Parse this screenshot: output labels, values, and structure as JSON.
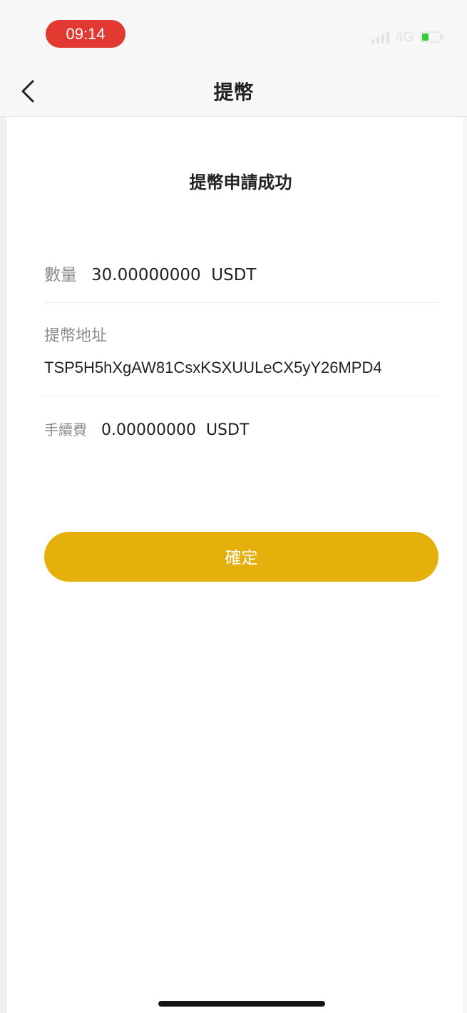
{
  "status_bar": {
    "time": "09:14",
    "network": "4G",
    "time_pill_color": "#e23a30",
    "battery_color": "#2fcf3a"
  },
  "header": {
    "title": "提幣",
    "back_icon": "chevron-left-icon"
  },
  "result": {
    "title": "提幣申請成功"
  },
  "details": {
    "amount_label": "數量",
    "amount_value": "30.00000000  USDT",
    "address_label": "提幣地址",
    "address_value": "TSP5H5hXgAW81CsxKSXUULeCX5yY26MPD4",
    "fee_label": "手續費",
    "fee_value": "0.00000000  USDT"
  },
  "actions": {
    "confirm_label": "確定",
    "confirm_color": "#e6b00c"
  }
}
